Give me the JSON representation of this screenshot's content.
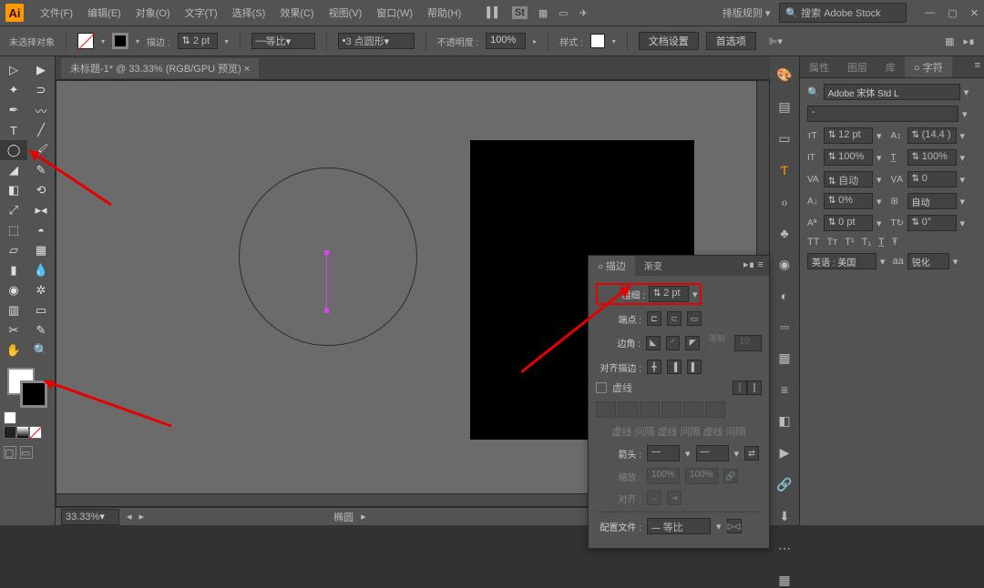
{
  "menu": {
    "items": [
      "文件(F)",
      "编辑(E)",
      "对象(O)",
      "文字(T)",
      "选择(S)",
      "效果(C)",
      "视图(V)",
      "窗口(W)",
      "帮助(H)"
    ],
    "layout_label": "排版规则",
    "search_ph": "搜索 Adobe Stock"
  },
  "optbar": {
    "noSelection": "未选择对象",
    "strokeLabel": "描边 :",
    "strokeVal": "2 pt",
    "profileLabel": "等比",
    "dashLabel": "3 点圆形",
    "opacityLabel": "不透明度 :",
    "opacityVal": "100%",
    "styleLabel": "样式 :",
    "docSetup": "文档设置",
    "prefs": "首选项"
  },
  "tab": {
    "title": "未标题-1* @ 33.33% (RGB/GPU 预览)",
    "close": "×"
  },
  "status": {
    "zoom": "33.33%",
    "tool": "椭圆"
  },
  "char": {
    "tabs": [
      "属性",
      "图层",
      "库",
      "字符"
    ],
    "font": "Adobe 宋体 Std L",
    "sub": "-",
    "size": "12 pt",
    "leading": "(14.4 )",
    "hscale": "100%",
    "vscale": "100%",
    "kerning": "自动",
    "tracking": "0",
    "baseline": "0%",
    "auto": "自动",
    "rise": "0 pt",
    "rot": "0°",
    "lang": "英语 : 美国",
    "aa": "锐化",
    "aaLabel": "aa"
  },
  "stroke_panel": {
    "tabs": [
      "描边",
      "渐变"
    ],
    "weight_l": "粗细 :",
    "weight_v": "2 pt",
    "cap_l": "端点 :",
    "corner_l": "边角 :",
    "limit_l": "限制 :",
    "limit_v": "10",
    "align_l": "对齐描边 :",
    "dash_l": "虚线",
    "arrow_l": "箭头 :",
    "scale_l": "缩放 :",
    "align2_l": "对齐 :",
    "profile_l": "配置文件 :",
    "profile_v": "等比",
    "disabled": [
      "虚线",
      "问隔",
      "虚线",
      "问隔",
      "虚线",
      "问隔"
    ]
  }
}
